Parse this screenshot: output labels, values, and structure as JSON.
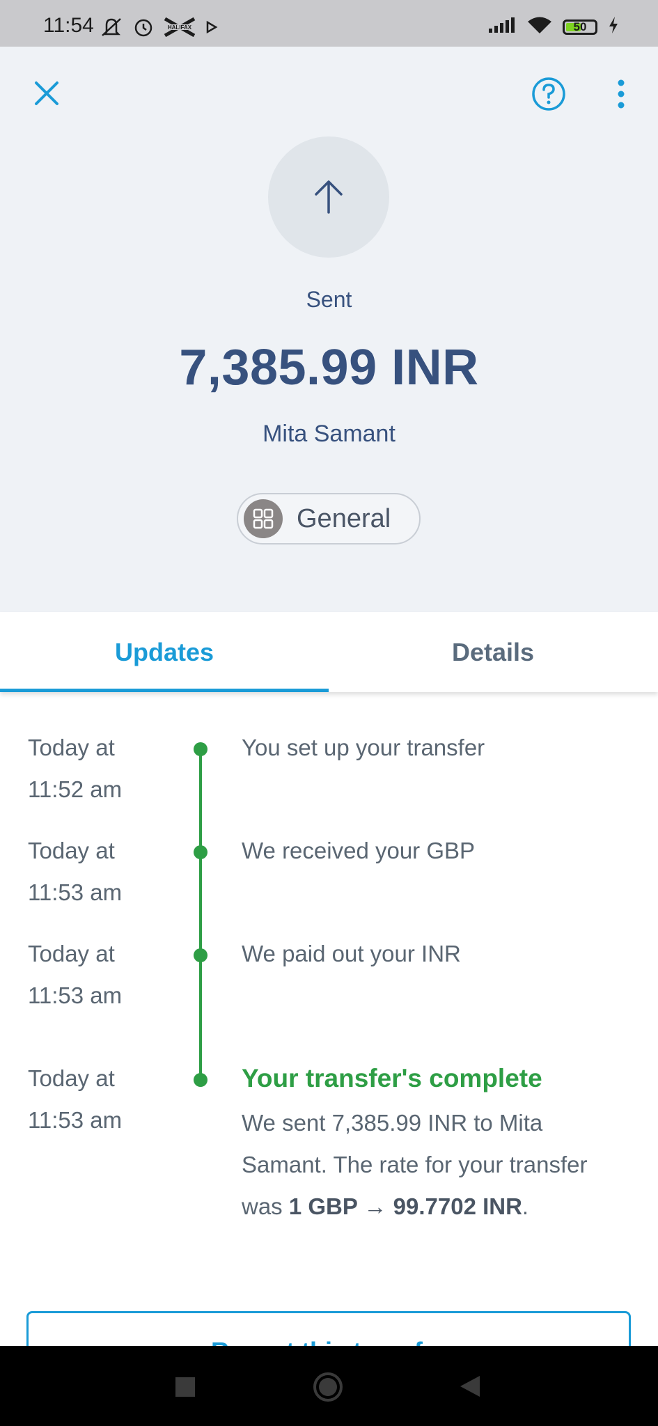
{
  "status_bar": {
    "time": "11:54",
    "battery_level": "50",
    "icons": [
      "mute-icon",
      "alarm-icon",
      "halifax-icon",
      "play-icon",
      "signal-icon",
      "wifi-icon",
      "battery-icon",
      "charging-icon"
    ]
  },
  "header": {
    "close_icon": "close-icon",
    "help_icon": "help-icon",
    "more_icon": "more-vertical-icon",
    "direction_icon": "arrow-up-icon",
    "status": "Sent",
    "amount": "7,385.99 INR",
    "recipient": "Mita Samant",
    "category": {
      "icon": "grid-icon",
      "label": "General"
    }
  },
  "tabs": [
    {
      "label": "Updates",
      "active": true
    },
    {
      "label": "Details",
      "active": false
    }
  ],
  "timeline": {
    "events": [
      {
        "date_line1": "Today at",
        "date_line2": "11:52 am",
        "text": "You set up your transfer"
      },
      {
        "date_line1": "Today at",
        "date_line2": "11:53 am",
        "text": "We received your GBP"
      },
      {
        "date_line1": "Today at",
        "date_line2": "11:53 am",
        "text": "We paid out your INR"
      },
      {
        "date_line1": "Today at",
        "date_line2": "11:53 am",
        "title": "Your transfer's complete",
        "desc_prefix": "We sent 7,385.99 INR to Mita Samant. The rate for your transfer was ",
        "desc_rate": "1 GBP → 99.7702 INR",
        "desc_suffix": "."
      }
    ]
  },
  "repeat_button": {
    "label": "Repeat this transfer"
  },
  "colors": {
    "accent": "#1a9bd7",
    "success": "#2e9e45",
    "primary_text": "#37517e",
    "header_bg": "#eff2f6"
  }
}
